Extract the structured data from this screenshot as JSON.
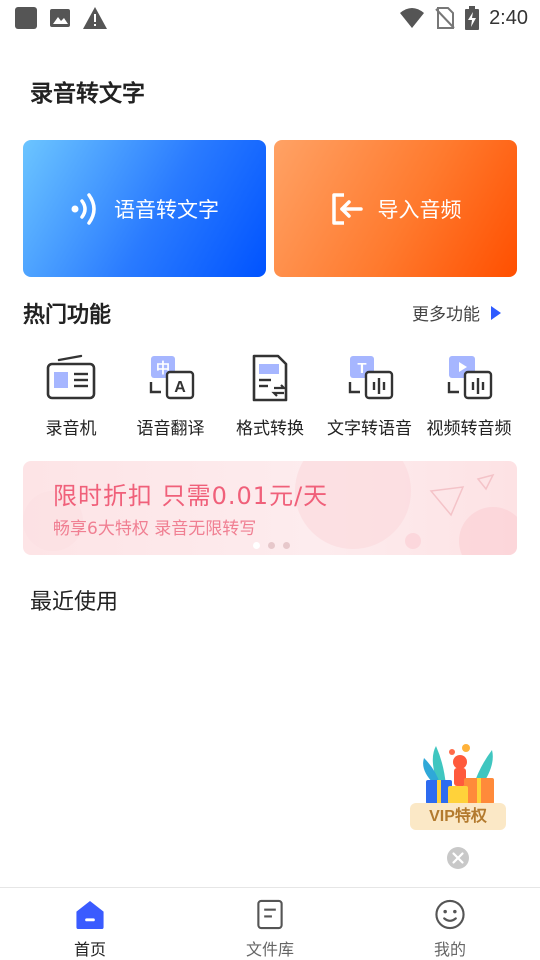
{
  "status_bar": {
    "time": "2:40",
    "left_icons": [
      "app-square-icon",
      "image-icon",
      "warning-icon"
    ],
    "right_icons": [
      "wifi-icon",
      "no-sim-icon",
      "battery-charging-icon"
    ]
  },
  "page": {
    "title": "录音转文字"
  },
  "hero": {
    "voice_to_text": {
      "label": "语音转文字",
      "icon": "sound-wave-icon"
    },
    "import_audio": {
      "label": "导入音频",
      "icon": "import-icon"
    }
  },
  "hot": {
    "title": "热门功能",
    "more_label": "更多功能",
    "items": [
      {
        "label": "录音机",
        "icon": "radio-icon"
      },
      {
        "label": "语音翻译",
        "icon": "translate-icon"
      },
      {
        "label": "格式转换",
        "icon": "format-convert-icon"
      },
      {
        "label": "文字转语音",
        "icon": "text-to-speech-icon"
      },
      {
        "label": "视频转音频",
        "icon": "video-to-audio-icon"
      }
    ]
  },
  "banner": {
    "title": "限时折扣 只需0.01元/天",
    "subtitle": "畅享6大特权 录音无限转写",
    "page_count": 3,
    "active_page": 1
  },
  "recent": {
    "title": "最近使用"
  },
  "vip": {
    "label": "VIP特权"
  },
  "tabbar": {
    "items": [
      {
        "label": "首页",
        "icon": "home-icon",
        "active": true
      },
      {
        "label": "文件库",
        "icon": "document-icon",
        "active": false
      },
      {
        "label": "我的",
        "icon": "smiley-icon",
        "active": false
      }
    ]
  },
  "colors": {
    "accent_blue": "#3a5bff",
    "accent_orange": "#ff6a1a",
    "banner_text": "#f0607a"
  }
}
